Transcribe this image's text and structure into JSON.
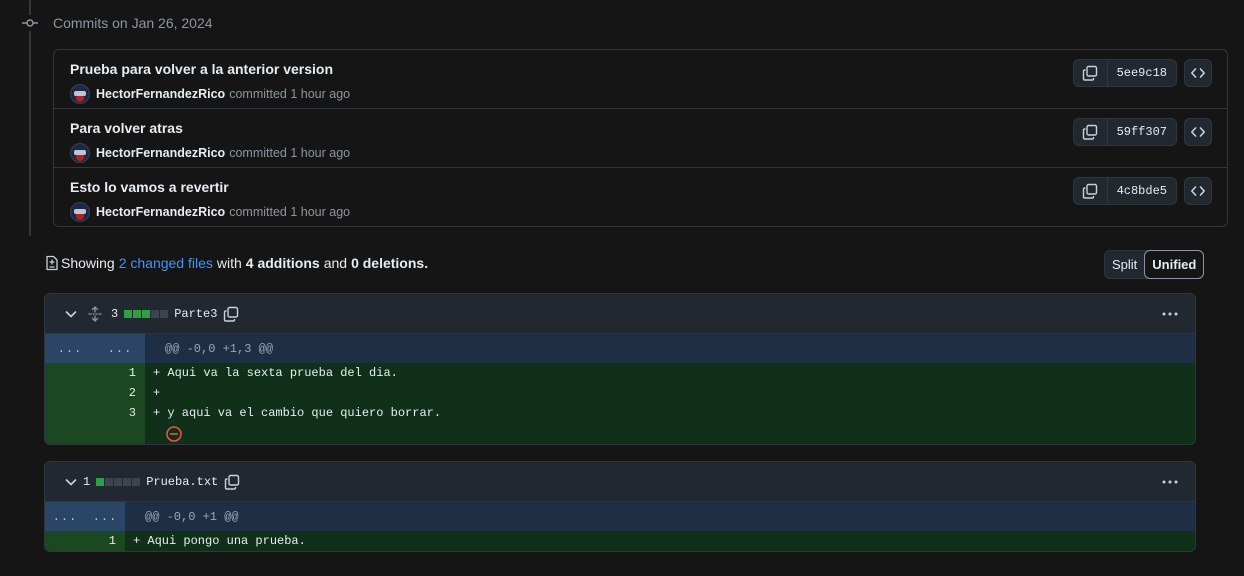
{
  "commits_heading": "Commits on Jan 26, 2024",
  "commits": [
    {
      "title": "Prueba para volver a la anterior version",
      "author": "HectorFernandezRico",
      "action": "committed",
      "time": "1 hour ago",
      "sha": "5ee9c18"
    },
    {
      "title": "Para volver atras",
      "author": "HectorFernandezRico",
      "action": "committed",
      "time": "1 hour ago",
      "sha": "59ff307"
    },
    {
      "title": "Esto lo vamos a revertir",
      "author": "HectorFernandezRico",
      "action": "committed",
      "time": "1 hour ago",
      "sha": "4c8bde5"
    }
  ],
  "summary": {
    "showing": "Showing",
    "changed_files": "2 changed files",
    "with": "with",
    "additions": "4 additions",
    "and": "and",
    "deletions": "0 deletions",
    "period": "."
  },
  "view_toggle": {
    "split": "Split",
    "unified": "Unified",
    "selected": "Unified"
  },
  "files": [
    {
      "name": "Parte3",
      "count": "3",
      "diffstat": [
        "add",
        "add",
        "add",
        "neutral",
        "neutral"
      ],
      "hunk": {
        "left": "...",
        "right": "...",
        "header": "@@ -0,0 +1,3 @@"
      },
      "lines": [
        {
          "num": "1",
          "code": "+ Aqui va la sexta prueba del dia."
        },
        {
          "num": "2",
          "code": "+"
        },
        {
          "num": "3",
          "code": "+ y aqui va el cambio que quiero borrar."
        }
      ]
    },
    {
      "name": "Prueba.txt",
      "count": "1",
      "diffstat": [
        "add",
        "neutral",
        "neutral",
        "neutral",
        "neutral"
      ],
      "hunk": {
        "left": "...",
        "right": "...",
        "header": "@@ -0,0 +1 @@"
      },
      "lines": [
        {
          "num": "1",
          "code": "+ Aqui pongo una prueba."
        }
      ]
    }
  ],
  "colors": {
    "accent_link": "#4493f8",
    "addition": "#2ea043",
    "background": "#151515",
    "deletion_icon": "#f85149"
  }
}
